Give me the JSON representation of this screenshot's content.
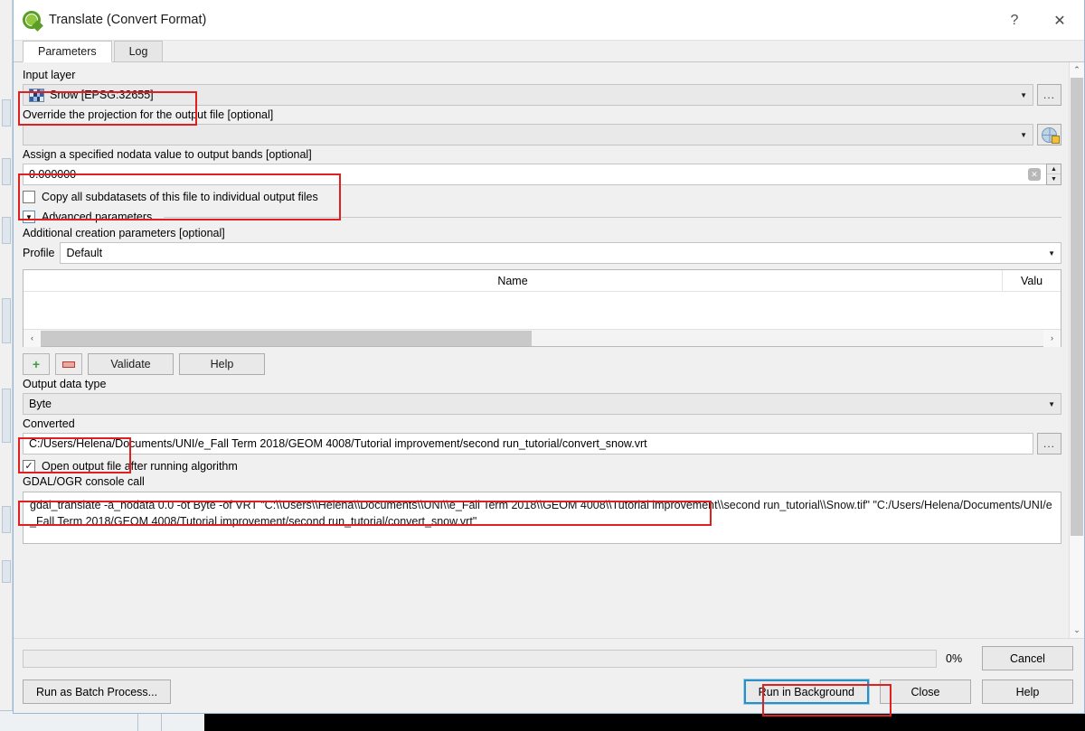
{
  "window": {
    "title": "Translate (Convert Format)",
    "app_icon": "qgis-icon",
    "help_btn": "?",
    "close_btn": "✕"
  },
  "tabs": [
    {
      "label": "Parameters",
      "active": true
    },
    {
      "label": "Log",
      "active": false
    }
  ],
  "parameters": {
    "input_layer": {
      "label": "Input layer",
      "value": "Snow [EPSG:32655]",
      "dropdown_arrow": "▼",
      "browse_label": "..."
    },
    "override_projection": {
      "label": "Override the projection for the output file [optional]",
      "value": "",
      "dropdown_arrow": "▼",
      "crs_icon": "globe-icon"
    },
    "nodata": {
      "label": "Assign a specified nodata value to output bands [optional]",
      "value": "0.000000",
      "clear_icon": "✕",
      "spin_up": "▲",
      "spin_down": "▼"
    },
    "copy_subdatasets": {
      "label": "Copy all subdatasets of this file to individual output files",
      "checked": false,
      "check_glyph": ""
    },
    "advanced": {
      "label": "Advanced parameters",
      "expanded": true,
      "toggle_glyph": "▼"
    },
    "additional_creation": {
      "label": "Additional creation parameters [optional]"
    },
    "profile": {
      "label": "Profile",
      "value": "Default",
      "dropdown_arrow": "▼"
    },
    "creation_table": {
      "columns": [
        "Name",
        "Valu"
      ],
      "rows": [],
      "hscroll_left": "‹",
      "hscroll_right": "›"
    },
    "table_tools": {
      "add_label": "+",
      "remove_label": "—",
      "validate_label": "Validate",
      "help_label": "Help"
    },
    "output_data_type": {
      "label": "Output data type",
      "value": "Byte",
      "dropdown_arrow": "▼"
    },
    "converted": {
      "label": "Converted",
      "value": "C:/Users/Helena/Documents/UNI/e_Fall Term 2018/GEOM 4008/Tutorial improvement/second run_tutorial/convert_snow.vrt",
      "browse_label": "..."
    },
    "open_output": {
      "label": "Open output file after running algorithm",
      "checked": true,
      "check_glyph": "✓"
    },
    "console": {
      "label": "GDAL/OGR console call",
      "value": "gdal_translate -a_nodata 0.0 -ot Byte -of VRT \"C:\\\\Users\\\\Helena\\\\Documents\\\\UNI\\\\e_Fall Term 2018\\\\GEOM 4008\\\\Tutorial improvement\\\\second run_tutorial\\\\Snow.tif\" \"C:/Users/Helena/Documents/UNI/e_Fall Term 2018/GEOM 4008/Tutorial improvement/second run_tutorial/convert_snow.vrt\""
    }
  },
  "bottom": {
    "progress_percent": "0%",
    "progress_value": 0,
    "cancel_label": "Cancel",
    "cancel_disabled": true,
    "batch_label": "Run as Batch Process...",
    "run_label": "Run in Background",
    "close_label": "Close",
    "help_label": "Help"
  },
  "scrollbars": {
    "v_up": "⌃",
    "v_down": "⌄"
  },
  "colors": {
    "annotation": "#e02020",
    "focus": "#2a8fc4",
    "dialog_bg": "#f0f0f0"
  }
}
